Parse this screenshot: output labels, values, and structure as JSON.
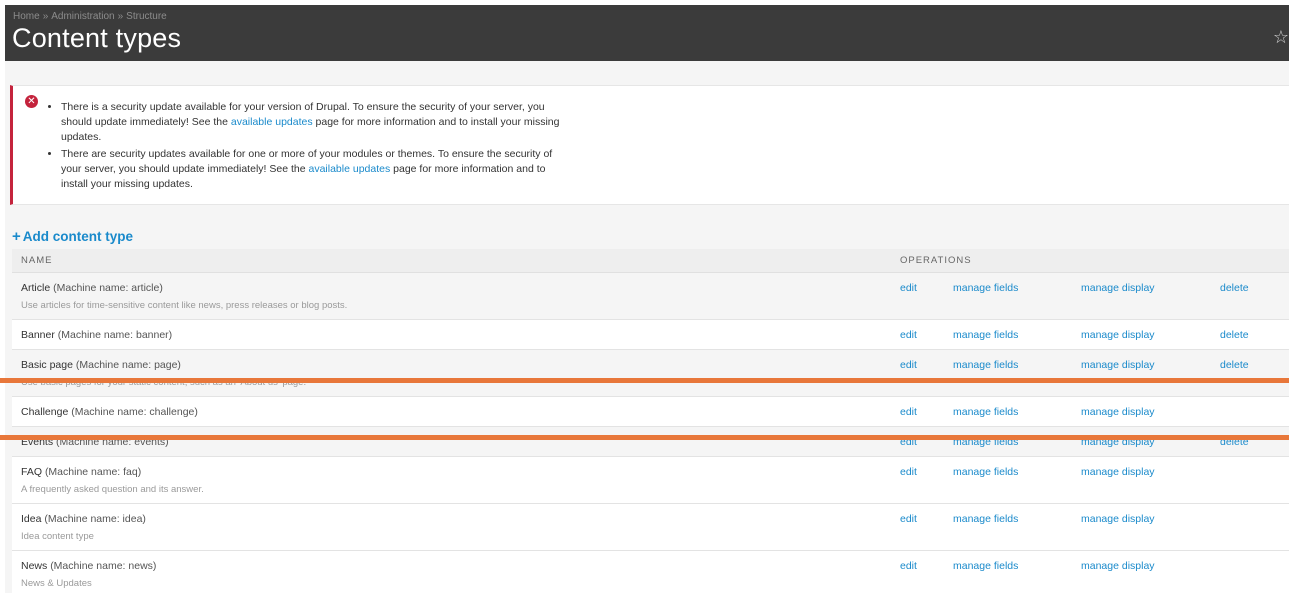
{
  "breadcrumb": [
    "Home",
    "Administration",
    "Structure"
  ],
  "breadcrumb_sep": "»",
  "page_title": "Content types",
  "messages": {
    "items": [
      {
        "before": "There is a security update available for your version of Drupal. To ensure the security of your server, you should update immediately! See the ",
        "link": "available updates",
        "after": " page for more information and to install your missing updates."
      },
      {
        "before": "There are security updates available for one or more of your modules or themes. To ensure the security of your server, you should update immediately! See the ",
        "link": "available updates",
        "after": " page for more information and to install your missing updates."
      }
    ]
  },
  "add_link": "Add content type",
  "table": {
    "headers": {
      "name": "NAME",
      "operations": "OPERATIONS"
    },
    "ops": {
      "edit": "edit",
      "manage_fields": "manage fields",
      "manage_display": "manage display",
      "delete": "delete"
    },
    "rows": [
      {
        "label": "Article",
        "machine": "(Machine name: article)",
        "desc": "Use articles for time-sensitive content like news, press releases or blog posts.",
        "delete": true
      },
      {
        "label": "Banner",
        "machine": "(Machine name: banner)",
        "desc": "",
        "delete": true
      },
      {
        "label": "Basic page",
        "machine": "(Machine name: page)",
        "desc": "Use basic pages for your static content, such as an 'About us' page.",
        "delete": true
      },
      {
        "label": "Challenge",
        "machine": "(Machine name: challenge)",
        "desc": "",
        "delete": false
      },
      {
        "label": "Events",
        "machine": "(Machine name: events)",
        "desc": "",
        "delete": true
      },
      {
        "label": "FAQ",
        "machine": "(Machine name: faq)",
        "desc": "A frequently asked question and its answer.",
        "delete": false
      },
      {
        "label": "Idea",
        "machine": "(Machine name: idea)",
        "desc": "Idea content type",
        "delete": false
      },
      {
        "label": "News",
        "machine": "(Machine name: news)",
        "desc": "News & Updates",
        "delete": false
      }
    ]
  },
  "colors": {
    "header": "#3b3b3b",
    "link": "#1a8acb",
    "error": "#c4233c",
    "overlay_line": "#e8773a"
  }
}
